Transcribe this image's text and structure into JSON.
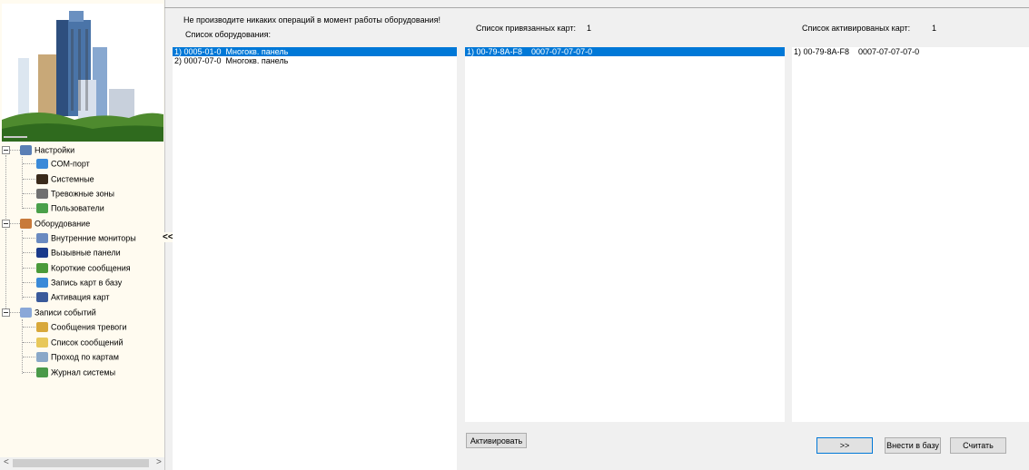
{
  "nav": {
    "collapse_glyph": "<<",
    "tree": [
      {
        "label": "Настройки",
        "icon": "settings-icon",
        "color": "#5a7fb5",
        "level": 0,
        "name": "tree-node-settings"
      },
      {
        "label": "COM-порт",
        "icon": "com-port-icon",
        "color": "#3a8ad8",
        "level": 1,
        "name": "tree-item-com-port"
      },
      {
        "label": "Системные",
        "icon": "system-icon",
        "color": "#3a2a1a",
        "level": 1,
        "name": "tree-item-system"
      },
      {
        "label": "Тревожные зоны",
        "icon": "alarm-zones-icon",
        "color": "#707070",
        "level": 1,
        "name": "tree-item-alarm-zones"
      },
      {
        "label": "Пользователи",
        "icon": "users-icon",
        "color": "#4aa04a",
        "level": 1,
        "name": "tree-item-users"
      },
      {
        "label": "Оборудование",
        "icon": "equipment-icon",
        "color": "#c87a3a",
        "level": 0,
        "name": "tree-node-equipment"
      },
      {
        "label": "Внутренние мониторы",
        "icon": "monitor-icon",
        "color": "#6a8ac0",
        "level": 1,
        "name": "tree-item-internal-monitors"
      },
      {
        "label": "Вызывные панели",
        "icon": "call-panel-icon",
        "color": "#1a3a8a",
        "level": 1,
        "name": "tree-item-call-panels"
      },
      {
        "label": "Короткие сообщения",
        "icon": "sms-icon",
        "color": "#4a9a3a",
        "level": 1,
        "name": "tree-item-short-messages"
      },
      {
        "label": "Запись карт в базу",
        "icon": "write-cards-icon",
        "color": "#3a8ad8",
        "level": 1,
        "name": "tree-item-write-cards"
      },
      {
        "label": "Активация карт",
        "icon": "activate-cards-icon",
        "color": "#3a5a9a",
        "level": 1,
        "name": "tree-item-activate-cards"
      },
      {
        "label": "Записи событий",
        "icon": "event-log-icon",
        "color": "#8aa8d8",
        "level": 0,
        "name": "tree-node-event-records"
      },
      {
        "label": "Сообщения тревоги",
        "icon": "alarm-messages-icon",
        "color": "#d8a83a",
        "level": 1,
        "name": "tree-item-alarm-messages"
      },
      {
        "label": "Список сообщений",
        "icon": "envelope-icon",
        "color": "#e8c85a",
        "level": 1,
        "name": "tree-item-message-list"
      },
      {
        "label": "Проход по картам",
        "icon": "card-pass-icon",
        "color": "#8aa8c8",
        "level": 1,
        "name": "tree-item-card-passage"
      },
      {
        "label": "Журнал системы",
        "icon": "system-journal-icon",
        "color": "#4a9a4a",
        "level": 1,
        "name": "tree-item-system-journal"
      }
    ],
    "scroll_left": "<",
    "scroll_right": ">"
  },
  "equipment": {
    "warning": "Не производите никаких операций в момент работы оборудования!",
    "list_label": "Список оборудования:",
    "items": [
      "1) 0005-01-0  Многокв. панель",
      "2) 0007-07-0  Многокв. панель"
    ]
  },
  "bound_cards": {
    "label": "Список привязанных карт:",
    "count": "1",
    "items": [
      "1) 00-79-8A-F8    0007-07-07-07-0"
    ],
    "activate_button": "Активировать"
  },
  "activated_cards": {
    "label": "Список активированых карт:",
    "count": "1",
    "items": [
      "1) 00-79-8A-F8    0007-07-07-07-0"
    ],
    "transfer_button": ">>",
    "db_button": "Внести в базу",
    "read_button": "Считать"
  },
  "colors": {
    "selection": "#0078d7",
    "tree_bg": "#fffbf0"
  }
}
